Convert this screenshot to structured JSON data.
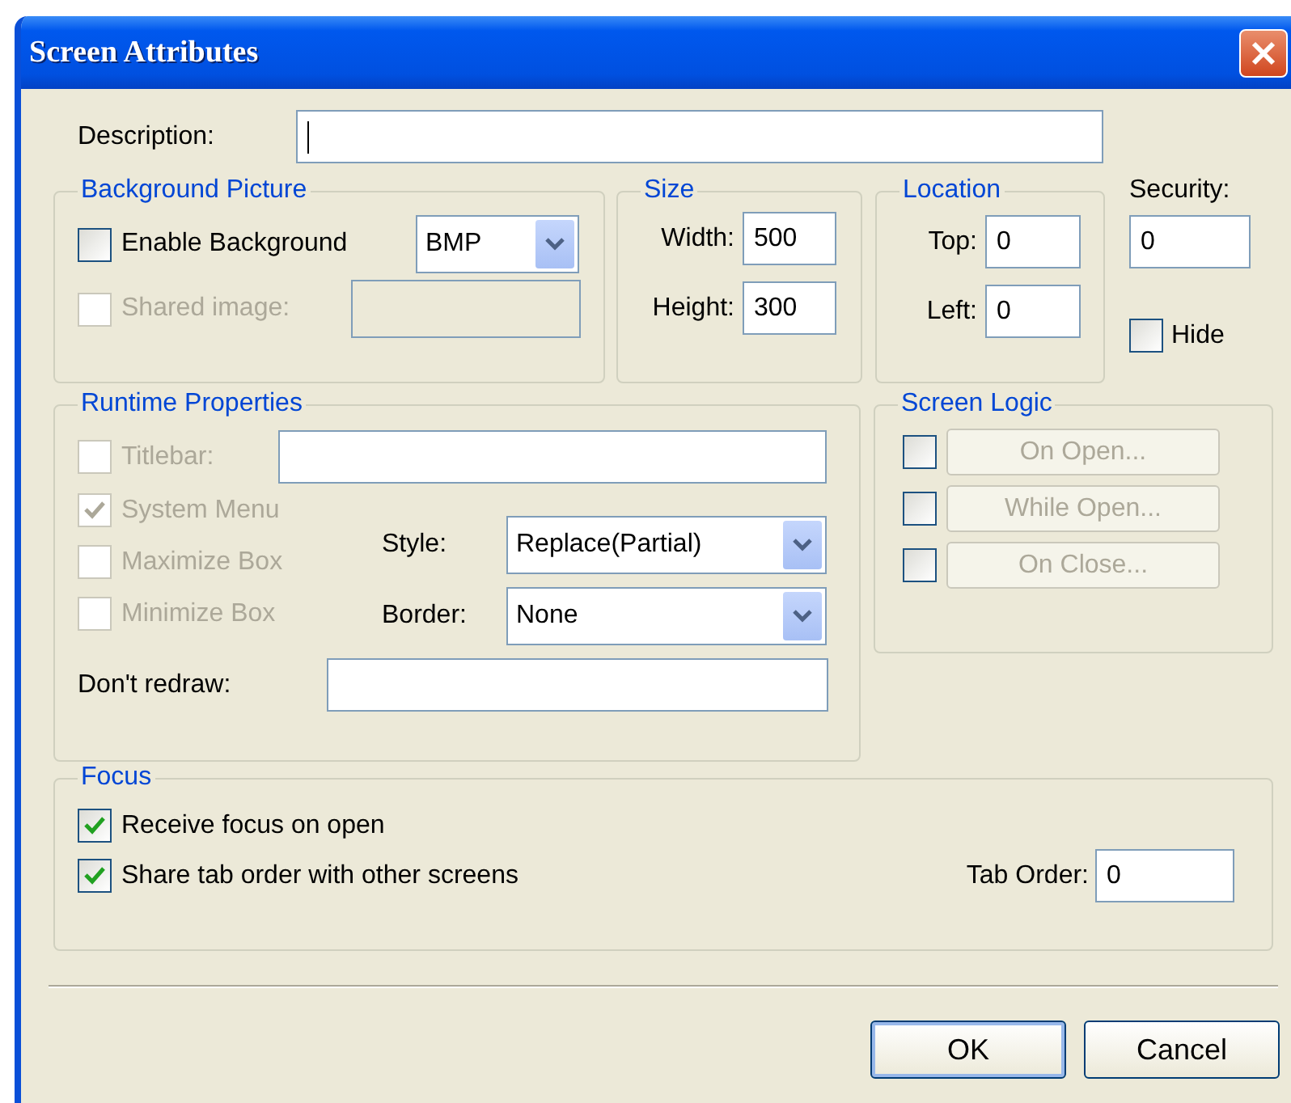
{
  "window": {
    "title": "Screen Attributes"
  },
  "description": {
    "label": "Description:"
  },
  "background_picture": {
    "title": "Background Picture",
    "enable": {
      "label": "Enable Background",
      "checked": false,
      "disabled": false
    },
    "format": {
      "value": "BMP"
    },
    "shared_image": {
      "label": "Shared image:",
      "checked": false,
      "disabled": true
    }
  },
  "size": {
    "title": "Size",
    "fields": [
      {
        "label": "Width:",
        "value": "500"
      },
      {
        "label": "Height:",
        "value": "300"
      }
    ]
  },
  "location": {
    "title": "Location",
    "fields": [
      {
        "label": "Top:",
        "value": "0"
      },
      {
        "label": "Left:",
        "value": "0"
      }
    ]
  },
  "security": {
    "label": "Security:",
    "value": "0"
  },
  "hide": {
    "label": "Hide",
    "checked": false
  },
  "runtime_properties": {
    "title": "Runtime Properties",
    "titlebar": {
      "label": "Titlebar:",
      "checked": false,
      "disabled": true
    },
    "options": [
      {
        "label": "System Menu",
        "checked": true,
        "disabled": true
      },
      {
        "label": "Maximize Box",
        "checked": false,
        "disabled": true
      },
      {
        "label": "Minimize Box",
        "checked": false,
        "disabled": true
      }
    ],
    "selects": [
      {
        "label": "Style:",
        "value": "Replace(Partial)"
      },
      {
        "label": "Border:",
        "value": "None"
      }
    ],
    "dont_redraw": {
      "label": "Don't redraw:"
    }
  },
  "screen_logic": {
    "title": "Screen Logic",
    "items": [
      {
        "label": "On Open...",
        "checked": false,
        "disabled": true
      },
      {
        "label": "While Open...",
        "checked": false,
        "disabled": true
      },
      {
        "label": "On Close...",
        "checked": false,
        "disabled": true
      }
    ]
  },
  "focus": {
    "title": "Focus",
    "options": [
      {
        "label": "Receive focus on open",
        "checked": true
      },
      {
        "label": "Share tab order with other screens",
        "checked": true
      }
    ],
    "tab_order": {
      "label": "Tab Order:",
      "value": "0"
    }
  },
  "buttons": [
    {
      "label": "OK",
      "default": true
    },
    {
      "label": "Cancel",
      "default": false
    }
  ]
}
